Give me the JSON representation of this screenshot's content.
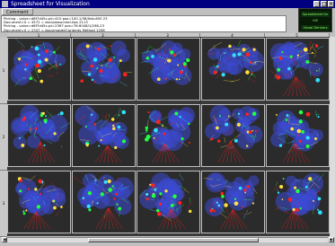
{
  "window": {
    "title": "Spreadsheet for Visualization"
  },
  "menu": {
    "comment_label": "Comment"
  },
  "log": {
    "lines": [
      "Picking - value=d6f7d45c-pt=410 pos=100.1/38/0da-600 23",
      "Document=0 = 4572 = docs/www.Intel.tips 2113",
      "Picking - value=d6f7d45c-pt=2367 pos=76.6048/1/298-23",
      "Document=0 = 2347 = docs/model/Contents Method 1206"
    ]
  },
  "logo": {
    "line1": "Spreadsheet for",
    "line2": "VIS",
    "line3": "Visual Derivers"
  },
  "columns": [
    "1",
    "2",
    "3",
    "4",
    "5"
  ],
  "rows": [
    "1",
    "2",
    "3"
  ],
  "colors": {
    "title_bar": "#000080",
    "cell_bg": "#2b2b2b",
    "blob_blue": "#3d4bd6",
    "red": "#ff2020",
    "green": "#20ff40",
    "cyan": "#30e0ff",
    "yellow": "#ffe040"
  }
}
